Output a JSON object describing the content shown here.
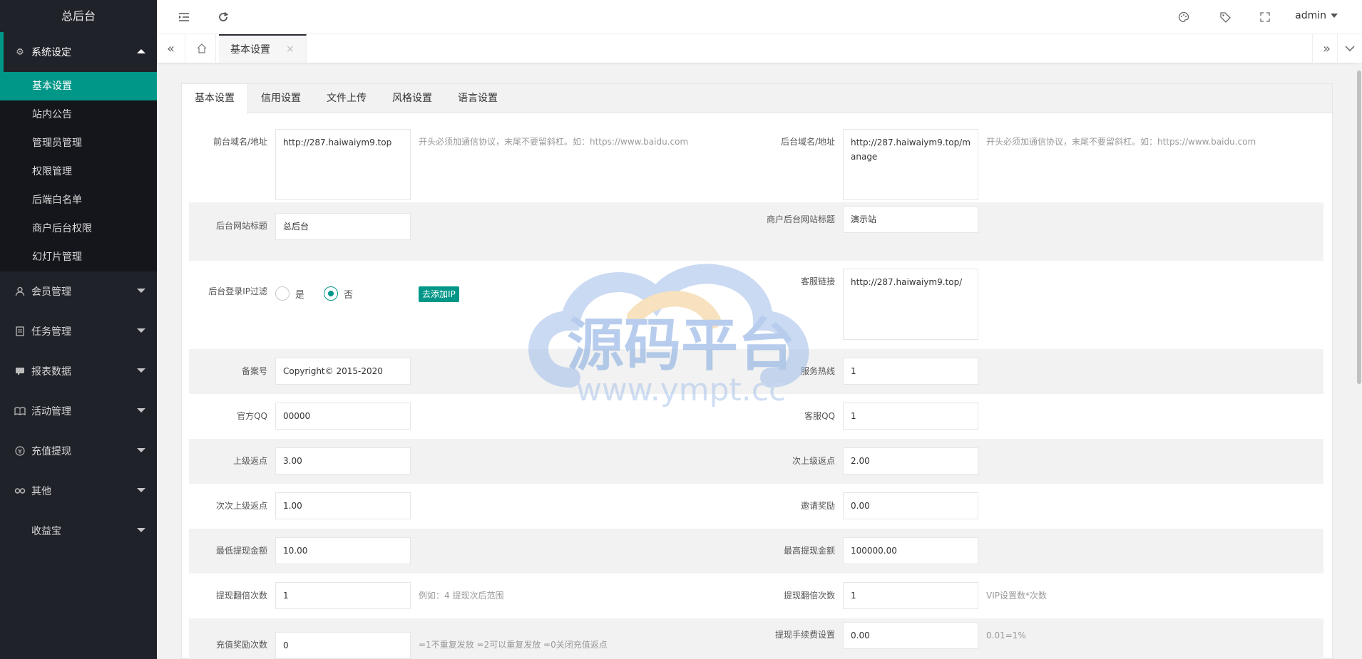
{
  "app": {
    "title": "总后台"
  },
  "sidebar": {
    "groups": [
      {
        "label": "系统设定",
        "icon": "gear-icon",
        "expanded": true,
        "items": [
          "基本设置",
          "站内公告",
          "管理员管理",
          "权限管理",
          "后端白名单",
          "商户后台权限",
          "幻灯片管理"
        ],
        "active_item": "基本设置"
      },
      {
        "label": "会员管理",
        "icon": "user-icon"
      },
      {
        "label": "任务管理",
        "icon": "document-icon"
      },
      {
        "label": "报表数据",
        "icon": "chat-icon"
      },
      {
        "label": "活动管理",
        "icon": "book-icon"
      },
      {
        "label": "充值提现",
        "icon": "yen-icon"
      },
      {
        "label": "其他",
        "icon": "link-icon"
      },
      {
        "label": "收益宝",
        "icon": ""
      }
    ]
  },
  "topbar": {
    "icons": [
      "collapse-menu-icon",
      "refresh-icon",
      "palette-icon",
      "tag-icon",
      "fullscreen-icon"
    ],
    "user": "admin"
  },
  "tabsbar": {
    "open_tab": "基本设置",
    "close": "×"
  },
  "settings_tabs": [
    "基本设置",
    "信用设置",
    "文件上传",
    "风格设置",
    "语言设置"
  ],
  "form": {
    "frontend_domain": {
      "label": "前台域名/地址",
      "value": "http://287.haiwaiym9.top",
      "hint": "开头必须加通信协议，末尾不要留斜杠。如：https://www.baidu.com"
    },
    "backend_domain": {
      "label": "后台域名/地址",
      "value": "http://287.haiwaiym9.top/manage",
      "hint": "开头必须加通信协议，末尾不要留斜杠。如：https://www.baidu.com"
    },
    "admin_title": {
      "label": "后台网站标题",
      "value": "总后台"
    },
    "merchant_title": {
      "label": "商户后台网站标题",
      "value": "演示站"
    },
    "ip_filter": {
      "label": "后台登录IP过滤",
      "yes": "是",
      "no": "否",
      "selected": "否",
      "button": "去添加IP"
    },
    "service_link": {
      "label": "客服链接",
      "value": "http://287.haiwaiym9.top/"
    },
    "icp": {
      "label": "备案号",
      "value": "Copyright© 2015-2020"
    },
    "hotline": {
      "label": "服务热线",
      "value": "1"
    },
    "official_qq": {
      "label": "官方QQ",
      "value": "00000"
    },
    "service_qq": {
      "label": "客服QQ",
      "value": "1"
    },
    "upper_rebate": {
      "label": "上级返点",
      "value": "3.00"
    },
    "second_rebate": {
      "label": "次上级返点",
      "value": "2.00"
    },
    "third_rebate": {
      "label": "次次上级返点",
      "value": "1.00"
    },
    "invite_reward": {
      "label": "邀请奖励",
      "value": "0.00"
    },
    "min_withdraw": {
      "label": "最低提现金额",
      "value": "10.00"
    },
    "max_withdraw": {
      "label": "最高提现金额",
      "value": "100000.00"
    },
    "withdraw_double_1": {
      "label": "提现翻倍次数",
      "value": "1",
      "hint": "例如：4 提现次后范围"
    },
    "withdraw_double_2": {
      "label": "提现翻倍次数",
      "value": "1",
      "hint": "VIP设置数*次数"
    },
    "recharge_reward": {
      "label": "充值奖励次数",
      "value": "0",
      "hint": "=1不重复发放 =2可以重复发放 =0关闭充值返点"
    },
    "withdraw_fee": {
      "label": "提现手续费设置",
      "value": "0.00",
      "hint": "0.01=1%"
    }
  },
  "watermark": {
    "cn": "源码平台",
    "url": "www.ympt.cc"
  },
  "colors": {
    "accent": "#009688",
    "sidebar": "#20222a",
    "submenu": "#15161b"
  }
}
